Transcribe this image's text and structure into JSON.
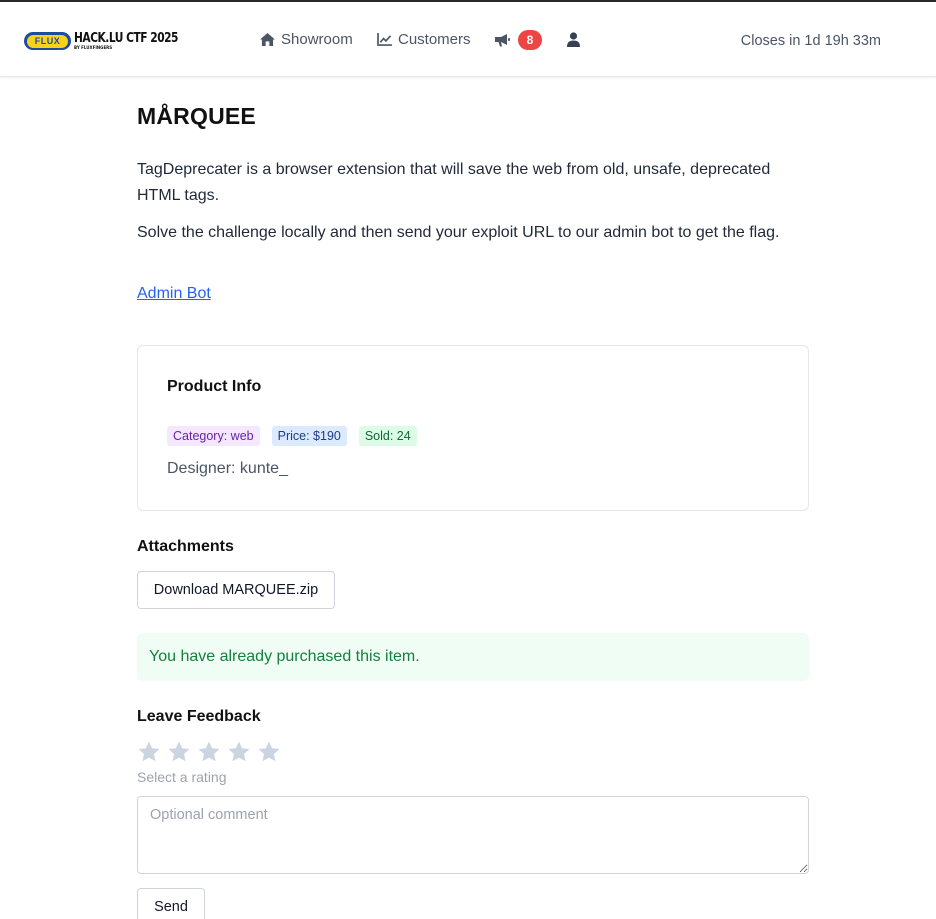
{
  "header": {
    "logo": {
      "badge": "FLUX",
      "title": "HACK.LU CTF 2025",
      "subtitle": "BY FLUXFINGERS"
    },
    "nav": {
      "showroom_label": "Showroom",
      "customers_label": "Customers",
      "notification_count": "8"
    },
    "closes_text": "Closes in 1d 19h 33m",
    "icons": [
      "home-icon",
      "chart-line-icon",
      "megaphone-icon",
      "user-icon"
    ]
  },
  "challenge": {
    "title": "MÅRQUEE",
    "description_1": "TagDeprecater is a browser extension that will save the web from old, unsafe, deprecated HTML tags.",
    "description_2": "Solve the challenge locally and then send your exploit URL to our admin bot to get the flag.",
    "admin_link_label": "Admin Bot"
  },
  "product_info": {
    "title": "Product Info",
    "category": "Category: web",
    "price": "Price: $190",
    "sold": "Sold: 24",
    "designer": "Designer: kunte_"
  },
  "attachments": {
    "title": "Attachments",
    "download_label": "Download MARQUEE.zip"
  },
  "purchase_status": "You have already purchased this item.",
  "feedback": {
    "title": "Leave Feedback",
    "rating_max": 5,
    "rating_value": 0,
    "rating_hint": "Select a rating",
    "comment_placeholder": "Optional comment",
    "comment_value": "",
    "send_label": "Send"
  },
  "colors": {
    "accent_link": "#2563eb",
    "badge_red": "#ef4444",
    "success_bg": "#f0fdf4",
    "success_text": "#15803d",
    "star_empty": "#cbd5e1"
  }
}
